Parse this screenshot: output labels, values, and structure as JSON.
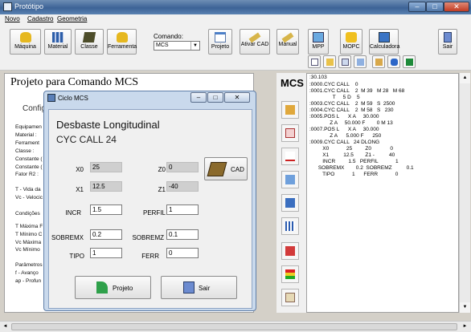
{
  "app": {
    "title": "Protótipo"
  },
  "menu": [
    {
      "label": "Novo"
    },
    {
      "label": "Cadastro"
    },
    {
      "label": "Geometria"
    }
  ],
  "toolbar": {
    "buttons": [
      {
        "label": "Máquina",
        "icon": "machine-icon"
      },
      {
        "label": "Material",
        "icon": "material-icon"
      },
      {
        "label": "Classe",
        "icon": "class-icon"
      },
      {
        "label": "Ferramenta",
        "icon": "tool-icon"
      },
      {
        "label": "Projeto",
        "icon": "project-icon"
      },
      {
        "label": "Ativar CAD",
        "icon": "ruler-icon"
      },
      {
        "label": "Manual",
        "icon": "manual-icon"
      },
      {
        "label": "MPP",
        "icon": "mpp-icon"
      },
      {
        "label": "MOPC",
        "icon": "mopc-icon"
      },
      {
        "label": "Calculadora",
        "icon": "calculator-icon"
      },
      {
        "label": "Sair",
        "icon": "exit-door-icon"
      }
    ],
    "command": {
      "label": "Comando:",
      "value": "MCS"
    }
  },
  "main": {
    "title": "Projeto para Comando MCS",
    "config_title": "Configu",
    "left_labels": [
      "Equipamen",
      "Material :",
      "Ferrament",
      "Classe :",
      "Constante (",
      "Constante (",
      "Fator R2 :",
      "T - Vida da",
      "Vc - Velocic",
      "Condições",
      "T Máxima F",
      "T Mínimo C",
      "Vc Máxima",
      "Vc Mínimo",
      "Parâmetros",
      "f - Avanço",
      "ap - Profun"
    ]
  },
  "mcs_panel": {
    "label": "MCS",
    "tools": [
      "settings-icon",
      "m30-icon",
      "wave-icon",
      "profile-icon",
      "contour-icon",
      "histogram-icon",
      "cut-icon",
      "traffic-light-icon",
      "document-icon"
    ]
  },
  "code": {
    "lines": [
      ":30.103",
      ":0000.CYC CALL    0",
      ":0001.CYC CALL    2  M 39   M 28   M 68",
      "                T     5 D    5",
      ":0003.CYC CALL    2  M 59   S  2500",
      ":0004.CYC CALL    2  M 58   S   230",
      ":0005.POS L      X A     30.000",
      "              Z A     50.000 F        0 M 13",
      ":0007.POS L      X A     30.000",
      "              Z A      5.000 F      250",
      ":0009.CYC CALL   24 DLONG",
      "         X0            25         Z0             0",
      "         X1          12.5        Z1 -          40",
      "         INCR         1.5   PERFIL            1",
      "      SOBREMX        0.2  SOBREMZ          0.1",
      "         TIPO            1      FERR            0"
    ]
  },
  "dialog": {
    "title": "Ciclo MCS",
    "heading": "Desbaste Longitudinal",
    "subheading": "CYC CALL 24",
    "fields": {
      "x0": {
        "label": "X0",
        "value": "25"
      },
      "z0": {
        "label": "Z0",
        "value": "0"
      },
      "x1": {
        "label": "X1",
        "value": "12.5"
      },
      "z1": {
        "label": "Z1",
        "value": "-40"
      },
      "incr": {
        "label": "INCR",
        "value": "1.5"
      },
      "perfil": {
        "label": "PERFIL",
        "value": "1"
      },
      "sobremx": {
        "label": "SOBREMX",
        "value": "0.2"
      },
      "sobremz": {
        "label": "SOBREMZ",
        "value": "0.1"
      },
      "tipo": {
        "label": "TIPO",
        "value": "1"
      },
      "ferr": {
        "label": "FERR",
        "value": "0"
      }
    },
    "cad_label": "CAD",
    "projeto_label": "Projeto",
    "sair_label": "Sair",
    "min_glyph": "–",
    "max_glyph": "□",
    "close_glyph": "✕"
  },
  "window_controls": {
    "min": "–",
    "max": "□",
    "close": "✕"
  },
  "scroll_glyphs": {
    "up": "▲",
    "down": "▼",
    "left": "◄",
    "right": "►"
  },
  "colors": {
    "title_bar": "#3d6396",
    "dialog_frame": "#c9d9ec",
    "close": "#c13b22"
  }
}
